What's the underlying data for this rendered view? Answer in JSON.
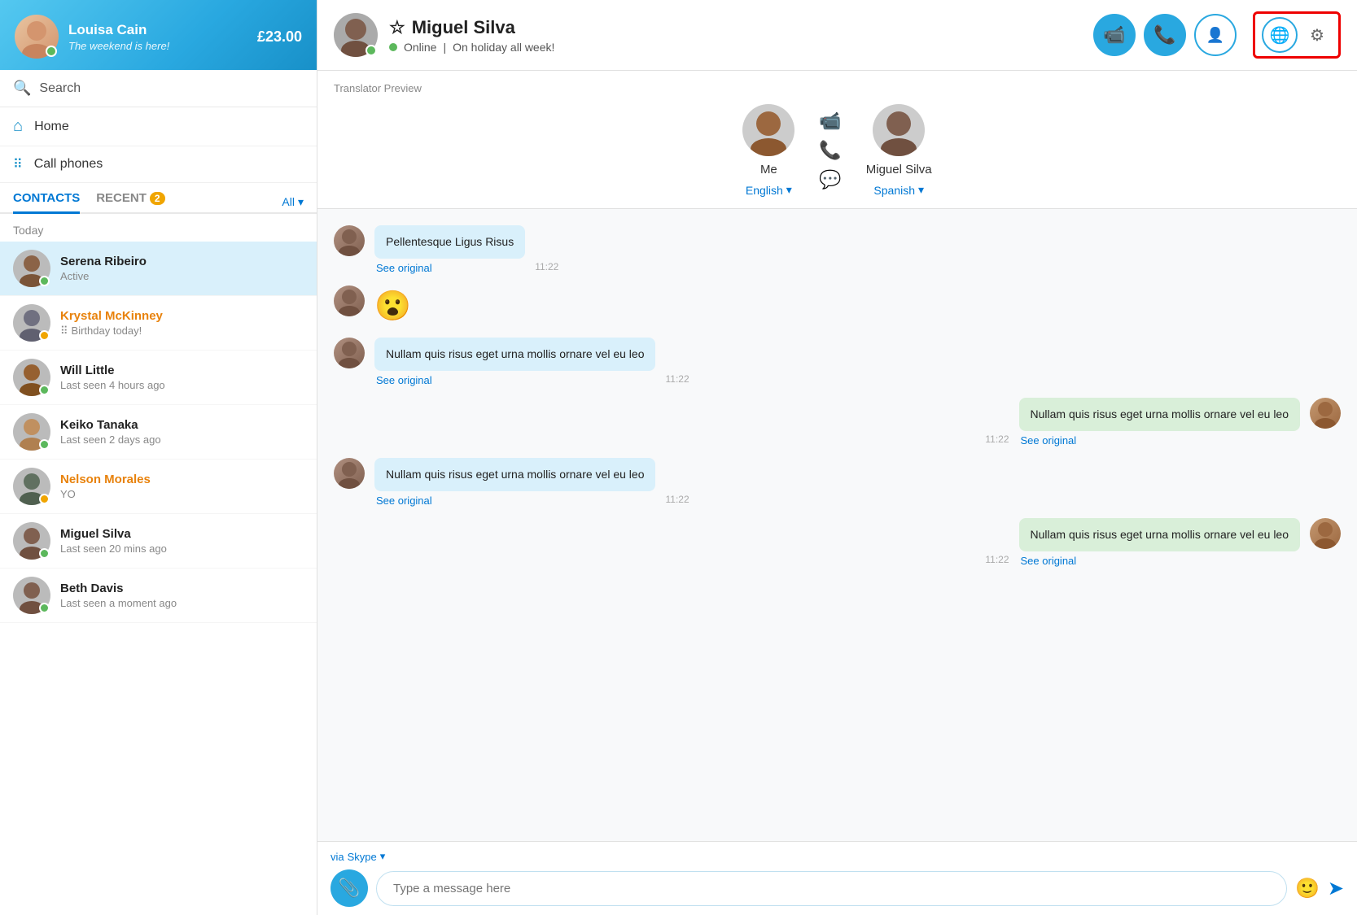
{
  "sidebar": {
    "profile": {
      "name": "Louisa Cain",
      "status": "The weekend is here!",
      "balance": "£23.00"
    },
    "search_label": "Search",
    "nav": [
      {
        "id": "home",
        "label": "Home",
        "icon": "⌂"
      },
      {
        "id": "call-phones",
        "label": "Call phones",
        "icon": "⠿"
      }
    ],
    "tabs": [
      {
        "id": "contacts",
        "label": "CONTACTS",
        "active": true
      },
      {
        "id": "recent",
        "label": "RECENT",
        "badge": "2"
      }
    ],
    "all_label": "All",
    "section_label": "Today",
    "contacts": [
      {
        "id": 1,
        "name": "Serena Ribeiro",
        "sub": "Active",
        "status": "online",
        "active": true,
        "name_color": "normal"
      },
      {
        "id": 2,
        "name": "Krystal McKinney",
        "sub": "Birthday today!",
        "status": "away",
        "active": false,
        "name_color": "orange",
        "has_birthday": true
      },
      {
        "id": 3,
        "name": "Will Little",
        "sub": "Last seen 4 hours ago",
        "status": "online",
        "active": false,
        "name_color": "normal"
      },
      {
        "id": 4,
        "name": "Keiko Tanaka",
        "sub": "Last seen 2 days ago",
        "status": "online",
        "active": false,
        "name_color": "normal"
      },
      {
        "id": 5,
        "name": "Nelson Morales",
        "sub": "YO",
        "status": "away",
        "active": false,
        "name_color": "orange"
      },
      {
        "id": 6,
        "name": "Miguel Silva",
        "sub": "Last seen 20 mins ago",
        "status": "online",
        "active": false,
        "name_color": "normal"
      },
      {
        "id": 7,
        "name": "Beth Davis",
        "sub": "Last seen a moment ago",
        "status": "online",
        "active": false,
        "name_color": "normal"
      }
    ]
  },
  "chat": {
    "contact_name": "Miguel Silva",
    "contact_status": "Online",
    "contact_status_extra": "On holiday all week!",
    "translator_preview_label": "Translator Preview",
    "me_label": "Me",
    "me_lang": "English",
    "them_lang": "Spanish",
    "messages": [
      {
        "id": 1,
        "side": "left",
        "text": "Pellentesque Ligus Risus",
        "see_original": "See original",
        "time": "11:22"
      },
      {
        "id": 2,
        "side": "left",
        "emoji": "😮",
        "time": ""
      },
      {
        "id": 3,
        "side": "left",
        "text": "Nullam quis risus eget urna mollis ornare vel eu leo",
        "see_original": "See original",
        "time": "11:22"
      },
      {
        "id": 4,
        "side": "right",
        "text": "Nullam quis risus eget urna mollis ornare vel eu leo",
        "see_original": "See original",
        "time": "11:22"
      },
      {
        "id": 5,
        "side": "left",
        "text": "Nullam quis risus eget urna mollis ornare vel eu leo",
        "see_original": "See original",
        "time": "11:22"
      },
      {
        "id": 6,
        "side": "right",
        "text": "Nullam quis risus eget urna mollis ornare vel eu leo",
        "see_original": "See original",
        "time": "11:22"
      }
    ],
    "via_label": "via",
    "via_service": "Skype",
    "input_placeholder": "Type a message here"
  },
  "icons": {
    "video_call": "📹",
    "phone_call": "📞",
    "add_contact": "👤+",
    "translator": "🌐",
    "gear": "⚙",
    "attach": "📎",
    "emoji": "🙂",
    "send": "➤",
    "search": "🔍",
    "home": "⌂",
    "call_phones_dots": "⠿",
    "star": "☆",
    "chevron_down": "▾"
  }
}
